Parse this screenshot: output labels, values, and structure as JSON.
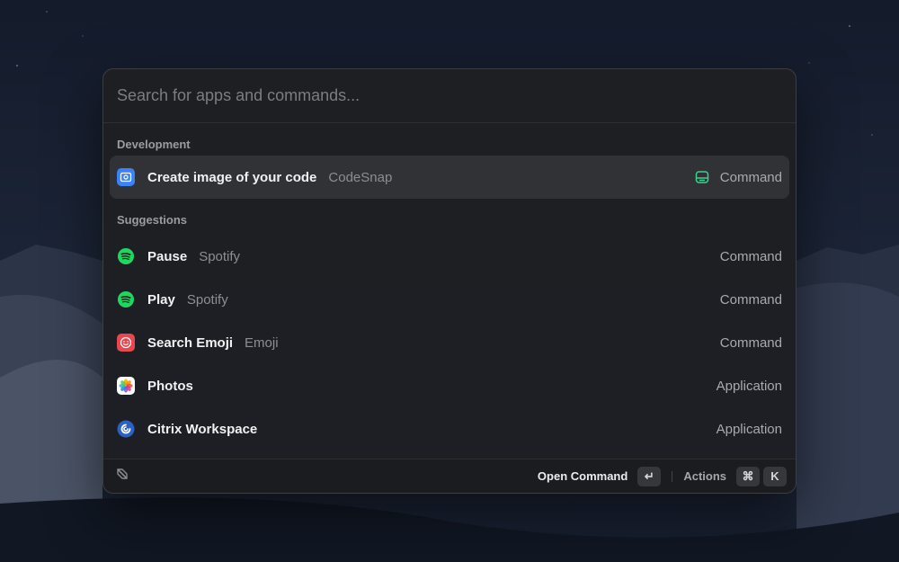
{
  "search": {
    "placeholder": "Search for apps and commands..."
  },
  "sections": [
    {
      "title": "Development",
      "items": [
        {
          "title": "Create image of your code",
          "subtitle": "CodeSnap",
          "type": "Command",
          "icon": "codesnap-icon",
          "accessory": "storage-icon",
          "selected": true
        }
      ]
    },
    {
      "title": "Suggestions",
      "items": [
        {
          "title": "Pause",
          "subtitle": "Spotify",
          "type": "Command",
          "icon": "spotify-icon"
        },
        {
          "title": "Play",
          "subtitle": "Spotify",
          "type": "Command",
          "icon": "spotify-icon"
        },
        {
          "title": "Search Emoji",
          "subtitle": "Emoji",
          "type": "Command",
          "icon": "emoji-icon"
        },
        {
          "title": "Photos",
          "subtitle": "",
          "type": "Application",
          "icon": "photos-icon"
        },
        {
          "title": "Citrix Workspace",
          "subtitle": "",
          "type": "Application",
          "icon": "citrix-icon"
        }
      ]
    }
  ],
  "footer": {
    "left_icon": "raycast-logo-icon",
    "primary_action": "Open Command",
    "primary_key": "↵",
    "actions_label": "Actions",
    "actions_keys": [
      "⌘",
      "K"
    ]
  },
  "colors": {
    "spotify": "#1ed760",
    "codesnap": "#3b82f6",
    "emoji": "#e5484d",
    "accessory": "#3ecf8e"
  }
}
